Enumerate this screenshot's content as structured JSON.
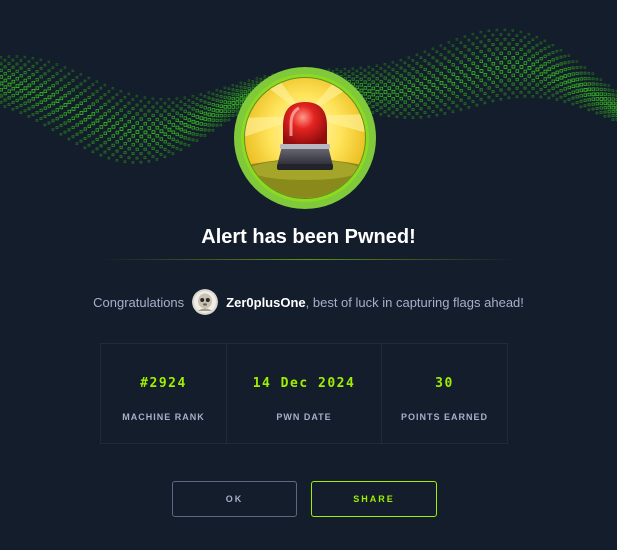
{
  "header": {
    "banner_icon": "green-hex-wave",
    "machine_icon": "alert-siren-icon"
  },
  "title": "Alert has been Pwned!",
  "congrats": {
    "prefix": "Congratulations",
    "avatar_icon": "user-avatar",
    "username": "Zer0plusOne",
    "suffix": ", best of luck in capturing flags ahead!"
  },
  "stats": [
    {
      "value": "#2924",
      "label": "MACHINE RANK"
    },
    {
      "value": "14 Dec 2024",
      "label": "PWN DATE"
    },
    {
      "value": "30",
      "label": "POINTS EARNED"
    }
  ],
  "buttons": {
    "ok_label": "OK",
    "share_label": "SHARE"
  },
  "colors": {
    "background": "#141d2b",
    "accent": "#9fef00",
    "muted_text": "#a4b1cd"
  }
}
